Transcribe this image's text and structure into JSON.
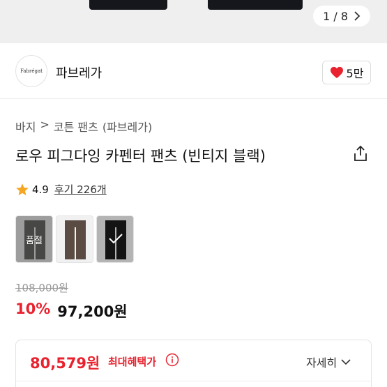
{
  "gallery": {
    "pager": "1 / 8",
    "next_icon": "chevron-right-icon"
  },
  "brand": {
    "logo_text": "Fabrégat",
    "name": "파브레가",
    "like_count": "5만"
  },
  "breadcrumb": [
    "바지",
    ">",
    "코튼 팬츠",
    "(파브레가)"
  ],
  "product": {
    "title": "로우 피그다잉 카펜터 팬츠 (빈티지 블랙)",
    "rating": "4.9",
    "reviews": "후기 226개"
  },
  "variants": [
    {
      "color": "#6e6d6a",
      "status": "품절"
    },
    {
      "color": "#5a4b43",
      "status": ""
    },
    {
      "color": "#1b1b1d",
      "status": "selected"
    }
  ],
  "price": {
    "original": "108,000원",
    "discount": "10%",
    "sale": "97,200원"
  },
  "benefit": {
    "best_price": "80,579원",
    "label": "최대혜택가",
    "more": "자세히"
  },
  "colors": {
    "accent": "#e8232f",
    "heart": "#e8232f",
    "star": "#f5a623"
  }
}
